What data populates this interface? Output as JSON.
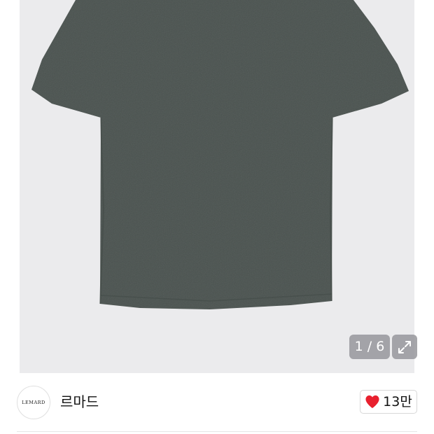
{
  "gallery": {
    "current_index": "1 / 6",
    "expand_icon": "expand-arrows-icon",
    "product_color": "#4a524f"
  },
  "seller": {
    "logo_text": "LEMARD",
    "name": "르마드"
  },
  "like": {
    "icon": "heart-icon",
    "count": "13만",
    "heart_color": "#e8202e"
  }
}
